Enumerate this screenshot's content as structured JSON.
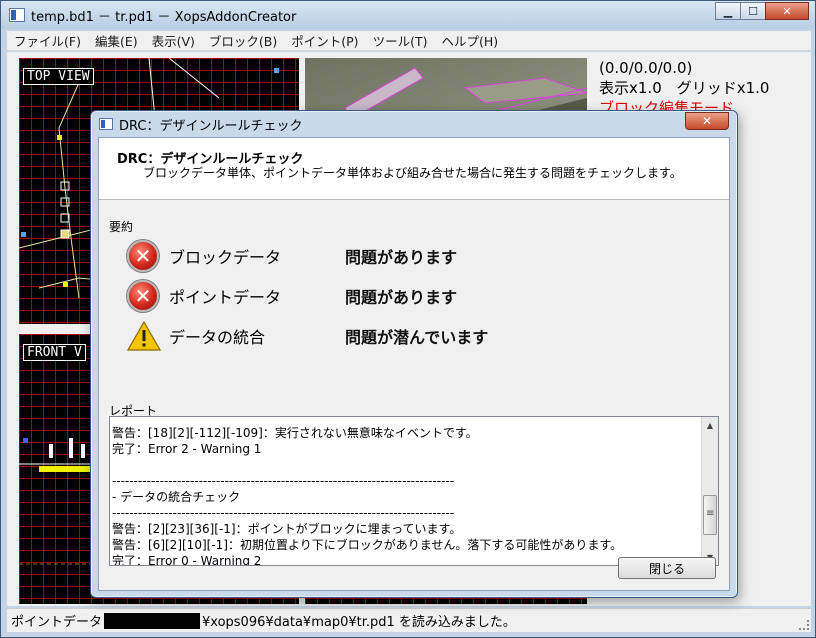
{
  "window": {
    "title": "temp.bd1 － tr.pd1 － XopsAddonCreator",
    "minimize": "▁",
    "maximize": "☐",
    "close": "✕"
  },
  "menu": [
    "ファイル(F)",
    "編集(E)",
    "表示(V)",
    "ブロック(B)",
    "ポイント(P)",
    "ツール(T)",
    "ヘルプ(H)"
  ],
  "viewports": {
    "top_label": "TOP VIEW",
    "front_label": "FRONT V"
  },
  "info": {
    "coords": "(0.0/0.0/0.0)",
    "zoom": "表示x1.0　グリッドx1.0",
    "mode": "ブロック編集モード",
    "colors": {
      "mode": "#e00000"
    }
  },
  "status": {
    "prefix": "ポイントデータ",
    "suffix": "¥xops096¥data¥map0¥tr.pd1 を読み込みました。"
  },
  "dialog": {
    "title": "DRC：デザインルールチェック",
    "close": "✕",
    "heading": "DRC：デザインルールチェック",
    "description": "ブロックデータ単体、ポイントデータ単体および組み合せた場合に発生する問題をチェックします。",
    "summary_label": "要約",
    "summary": [
      {
        "icon": "error-icon",
        "name": "ブロックデータ",
        "status": "問題があります"
      },
      {
        "icon": "error-icon",
        "name": "ポイントデータ",
        "status": "問題があります"
      },
      {
        "icon": "warning-icon",
        "name": "データの統合",
        "status": "問題が潜んでいます"
      }
    ],
    "error_glyph": "✕",
    "report_label": "レポート",
    "report_lines": [
      "警告：[18][2][-112][-109]：実行されない無意味なイベントです。",
      "完了：Error 2 - Warning 1",
      "",
      "-------------------------------------------------------------------------------",
      "- データの統合チェック",
      "-------------------------------------------------------------------------------",
      "警告：[2][23][36][-1]：ポイントがブロックに埋まっています。",
      "警告：[6][2][10][-1]：初期位置より下にブロックがありません。落下する可能性があります。",
      "完了：Error 0 - Warning 2"
    ],
    "close_button": "閉じる"
  }
}
